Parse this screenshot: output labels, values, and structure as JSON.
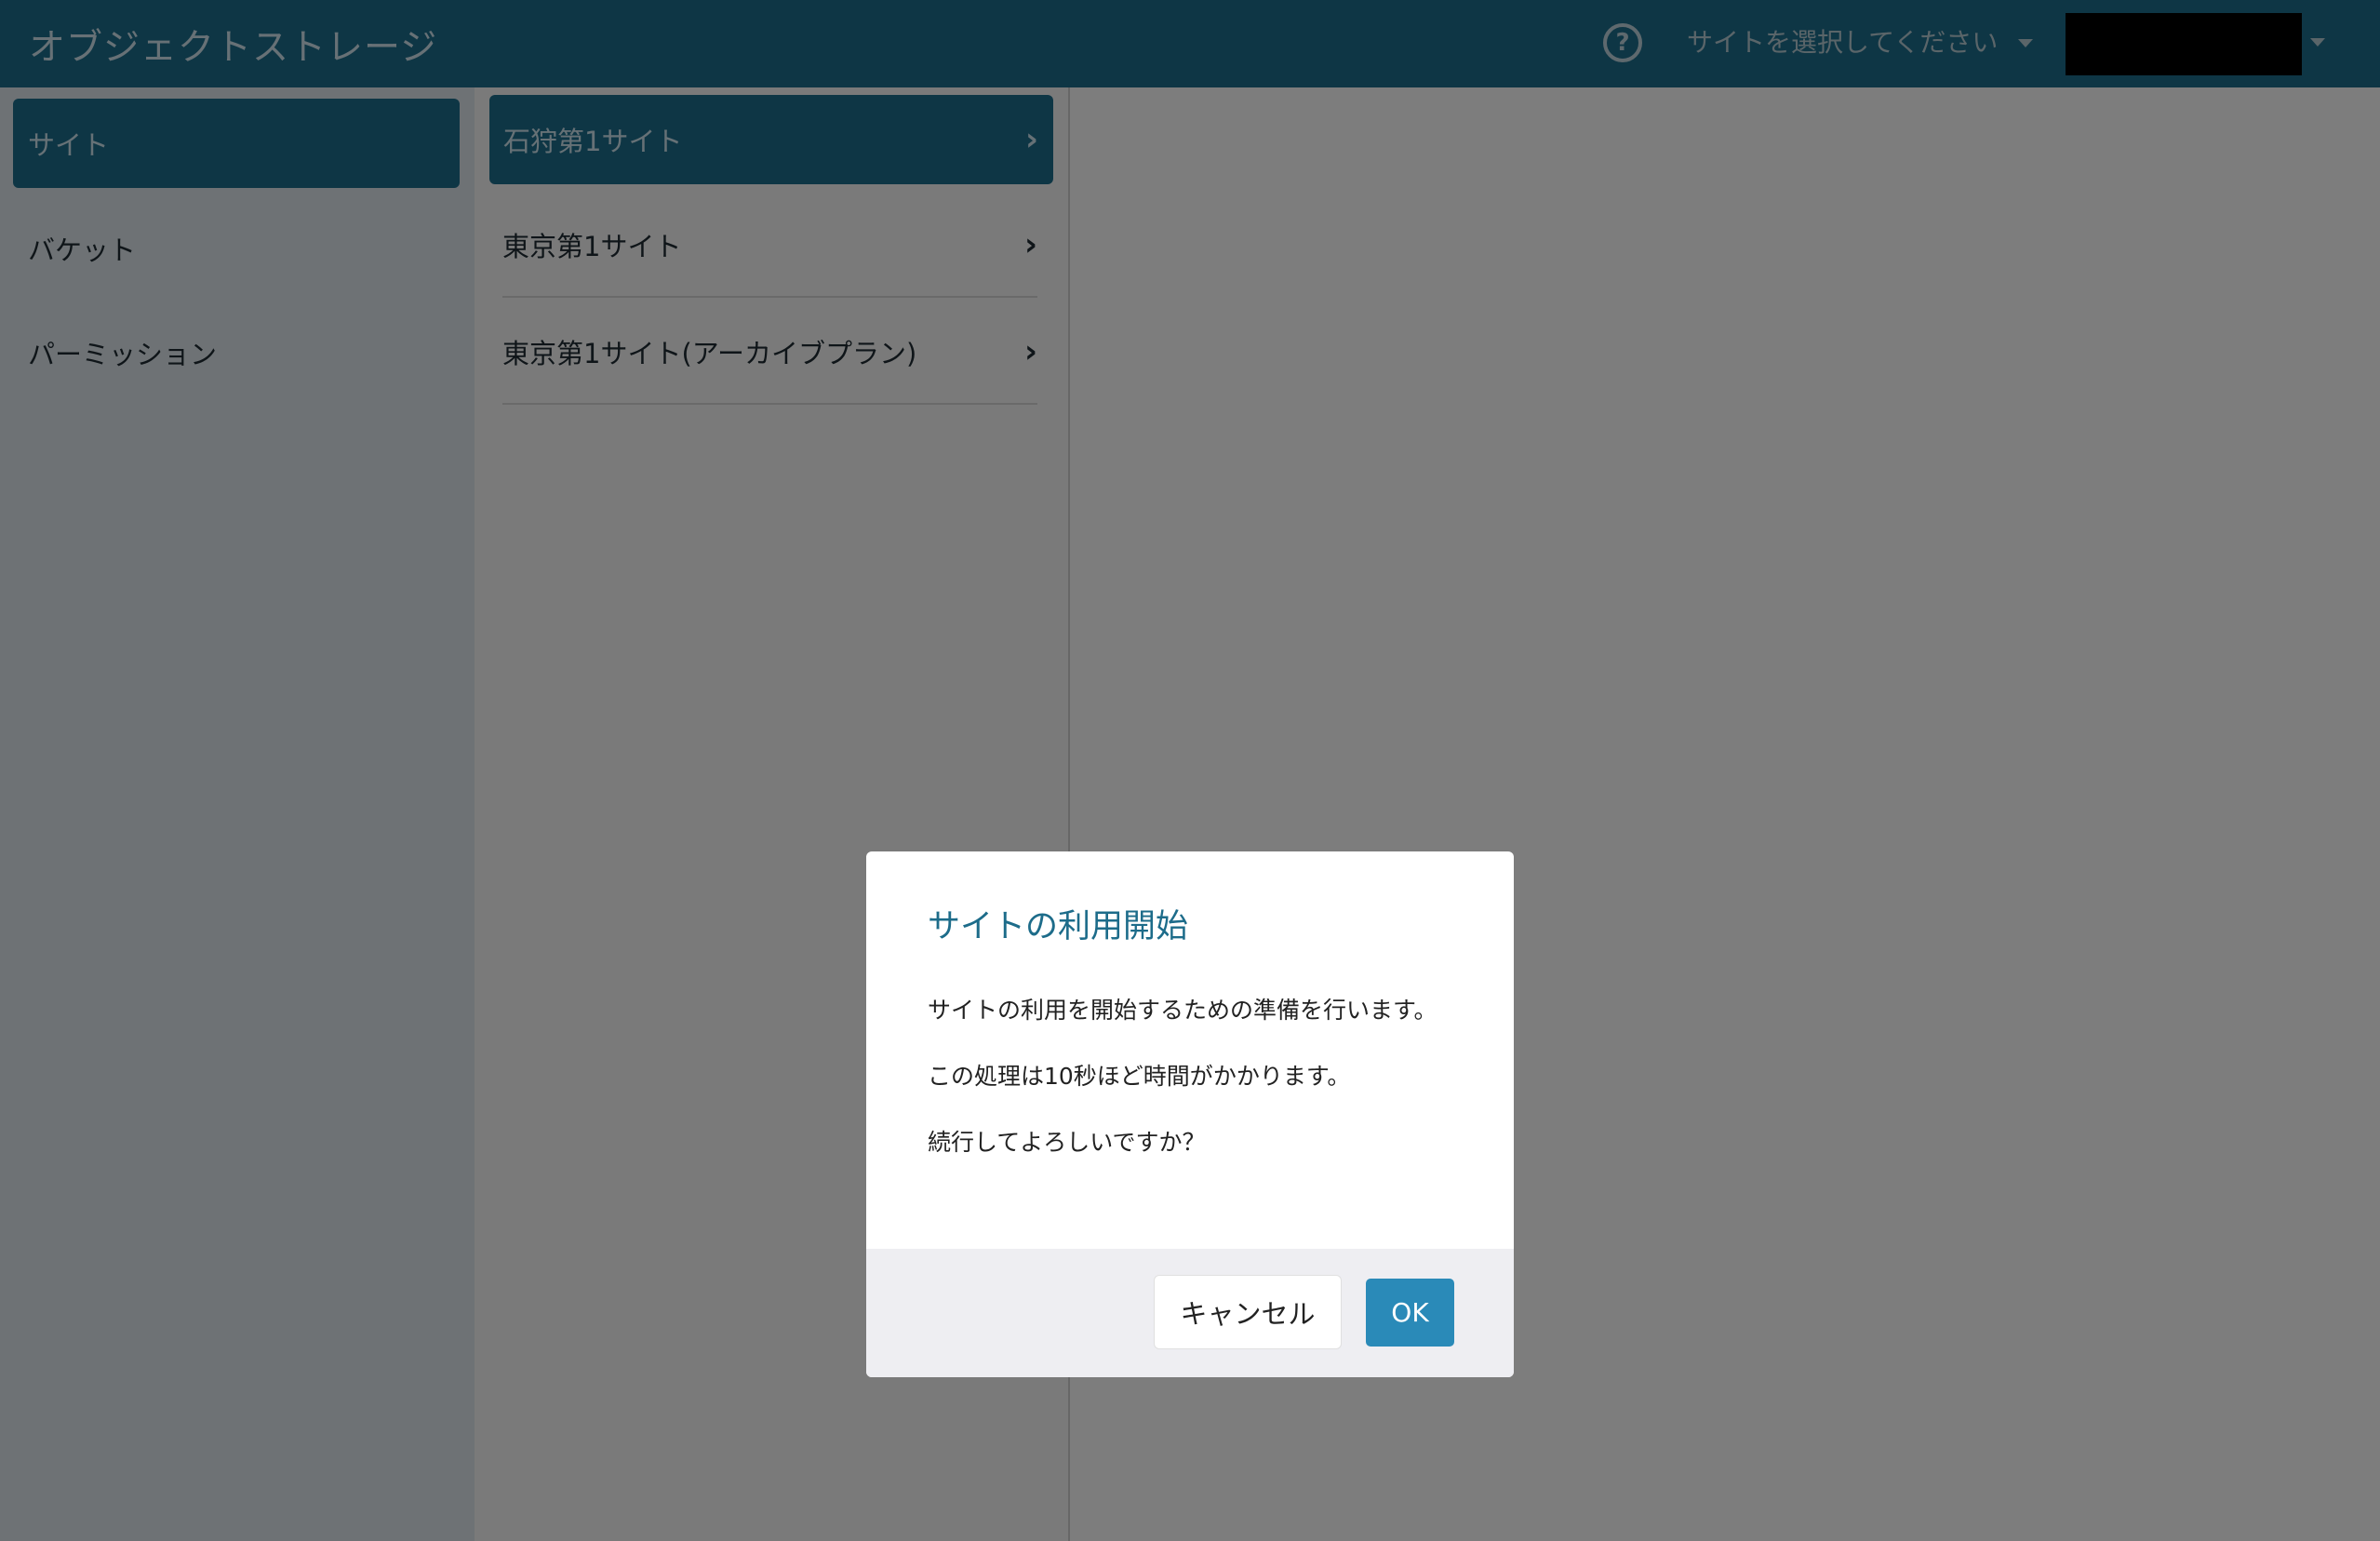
{
  "header": {
    "title": "オブジェクトストレージ",
    "help_icon": "question-circle-icon",
    "site_select_label": "サイトを選択してください",
    "user_label": ""
  },
  "sidebar": {
    "items": [
      {
        "label": "サイト",
        "active": true
      },
      {
        "label": "バケット",
        "active": false
      },
      {
        "label": "パーミッション",
        "active": false
      }
    ]
  },
  "sites": {
    "items": [
      {
        "label": "石狩第1サイト",
        "active": true
      },
      {
        "label": "東京第1サイト",
        "active": false
      },
      {
        "label": "東京第1サイト(アーカイブプラン)",
        "active": false
      }
    ],
    "chevron": "›"
  },
  "modal": {
    "title": "サイトの利用開始",
    "lines": [
      "サイトの利用を開始するための準備を行います。",
      "この処理は10秒ほど時間がかかります。",
      "続行してよろしいですか？"
    ],
    "cancel_label": "キャンセル",
    "ok_label": "OK"
  },
  "colors": {
    "primary": "#1d6c8a",
    "ok_button": "#2a8ab8",
    "overlay": "rgba(0,0,0,0.5)"
  }
}
